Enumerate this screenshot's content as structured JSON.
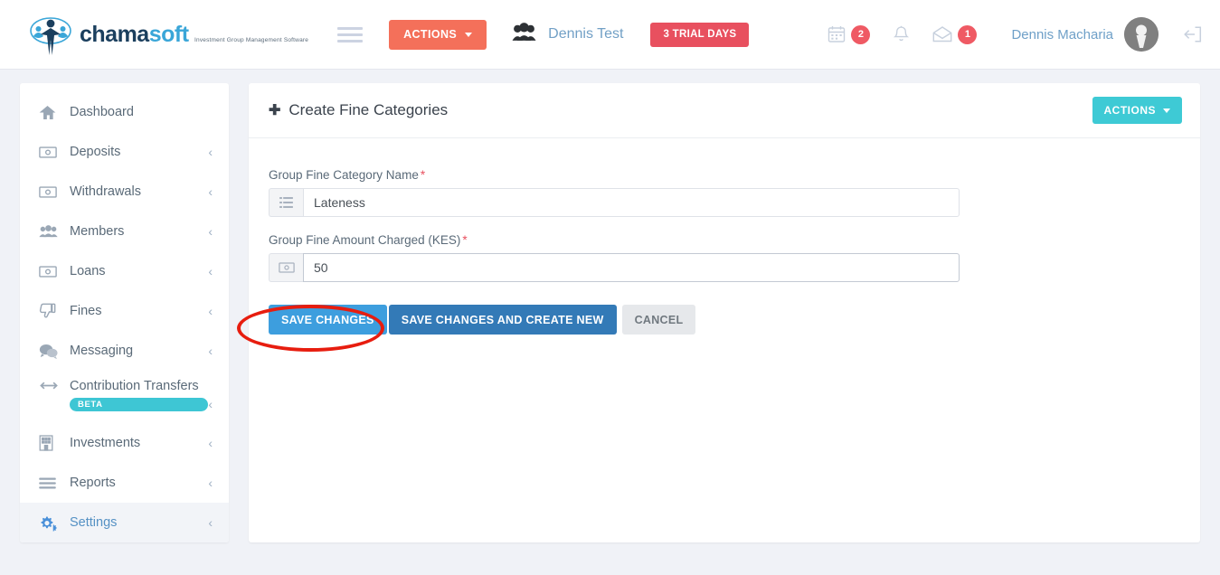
{
  "header": {
    "logo": {
      "brand_first": "chama",
      "brand_second": "soft",
      "tagline": "Investment Group Management Software",
      "icon": "chamasoft-people-logo"
    },
    "menu_toggle_icon": "hamburger-icon",
    "actions_button": {
      "label": "ACTIONS",
      "caret_icon": "chevron-down-icon",
      "color": "#f4705a"
    },
    "group": {
      "icon": "users-group-icon",
      "name": "Dennis Test"
    },
    "trial_badge": {
      "label": "3 TRIAL DAYS",
      "color": "#e8505f"
    },
    "calendar": {
      "icon": "calendar-icon",
      "badge": "2"
    },
    "bell": {
      "icon": "bell-icon",
      "badge": ""
    },
    "mail": {
      "icon": "envelope-open-icon",
      "badge": "1"
    },
    "user": {
      "name": "Dennis Macharia",
      "avatar_icon": "user-avatar-icon"
    },
    "logout": {
      "icon": "logout-icon"
    },
    "badge_color": "#ef5a64"
  },
  "sidebar": {
    "items": [
      {
        "label": "Dashboard",
        "icon": "home-icon",
        "caret": "",
        "active": false
      },
      {
        "label": "Deposits",
        "icon": "money-bill-icon",
        "caret": "‹",
        "active": false
      },
      {
        "label": "Withdrawals",
        "icon": "money-bill-icon",
        "caret": "‹",
        "active": false
      },
      {
        "label": "Members",
        "icon": "users-group-icon",
        "caret": "‹",
        "active": false
      },
      {
        "label": "Loans",
        "icon": "money-bill-icon",
        "caret": "‹",
        "active": false
      },
      {
        "label": "Fines",
        "icon": "thumbs-down-icon",
        "caret": "‹",
        "active": false
      },
      {
        "label": "Messaging",
        "icon": "comments-icon",
        "caret": "‹",
        "active": false
      },
      {
        "label": "Contribution Transfers",
        "icon": "arrows-left-right-icon",
        "caret": "‹",
        "active": false,
        "badge": "BETA"
      },
      {
        "label": "Investments",
        "icon": "building-icon",
        "caret": "‹",
        "active": false
      },
      {
        "label": "Reports",
        "icon": "bars-icon",
        "caret": "‹",
        "active": false
      },
      {
        "label": "Settings",
        "icon": "gears-icon",
        "caret": "‹",
        "active": true
      }
    ],
    "active_color": "#5591c4",
    "beta_color": "#3ec6d4"
  },
  "panel": {
    "title": "Create Fine Categories",
    "title_icon": "plus-icon",
    "actions_button": {
      "label": "ACTIONS",
      "caret_icon": "chevron-down-icon",
      "color": "#3ecad5"
    },
    "fields": [
      {
        "label": "Group Fine Category Name",
        "required": "*",
        "addon_icon": "list-icon",
        "value": "Lateness",
        "placeholder": ""
      },
      {
        "label": "Group Fine Amount Charged (KES)",
        "required": "*",
        "addon_icon": "money-bill-icon",
        "value": "50",
        "placeholder": ""
      }
    ],
    "buttons": {
      "save": {
        "label": "SAVE CHANGES",
        "color": "#3d9ede"
      },
      "save_new": {
        "label": "SAVE CHANGES AND CREATE NEW",
        "color": "#337ab7"
      },
      "cancel": {
        "label": "CANCEL",
        "color": "#e6e8eb"
      }
    }
  },
  "annotation": {
    "shape": "ellipse",
    "color": "#e71d0f",
    "target": "save-changes-button"
  }
}
